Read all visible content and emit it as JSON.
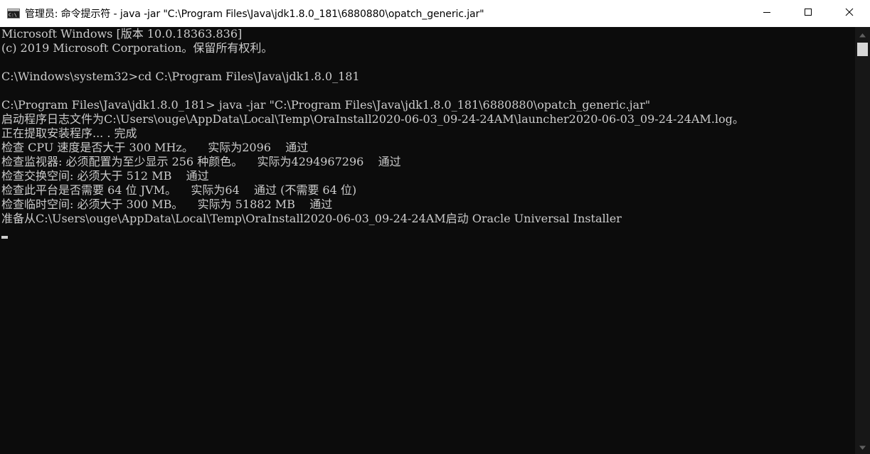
{
  "window": {
    "title": "管理员: 命令提示符 - java  -jar \"C:\\Program Files\\Java\\jdk1.8.0_181\\6880880\\opatch_generic.jar\"",
    "app_icon": "console-icon",
    "controls": {
      "minimize_icon": "minimize-icon",
      "maximize_icon": "maximize-icon",
      "close_icon": "close-icon"
    }
  },
  "console": {
    "lines": [
      "Microsoft Windows [版本 10.0.18363.836]",
      "(c) 2019 Microsoft Corporation。保留所有权利。",
      "",
      "C:\\Windows\\system32>cd C:\\Program Files\\Java\\jdk1.8.0_181",
      "",
      "C:\\Program Files\\Java\\jdk1.8.0_181> java -jar \"C:\\Program Files\\Java\\jdk1.8.0_181\\6880880\\opatch_generic.jar\"",
      "启动程序日志文件为C:\\Users\\ouge\\AppData\\Local\\Temp\\OraInstall2020-06-03_09-24-24AM\\launcher2020-06-03_09-24-24AM.log。",
      "正在提取安装程序... . 完成",
      "检查 CPU 速度是否大于 300 MHz。    实际为2096    通过",
      "检查监视器: 必须配置为至少显示 256 种颜色。    实际为4294967296    通过",
      "检查交换空间: 必须大于 512 MB    通过",
      "检查此平台是否需要 64 位 JVM。    实际为64    通过 (不需要 64 位)",
      "检查临时空间: 必须大于 300 MB。    实际为 51882 MB    通过",
      "准备从C:\\Users\\ouge\\AppData\\Local\\Temp\\OraInstall2020-06-03_09-24-24AM启动 Oracle Universal Installer"
    ]
  },
  "scrollbar": {
    "up_icon": "scroll-up-icon",
    "down_icon": "scroll-down-icon"
  },
  "colors": {
    "console_bg": "#0c0c0c",
    "console_text": "#cccccc",
    "titlebar_bg": "#ffffff"
  }
}
